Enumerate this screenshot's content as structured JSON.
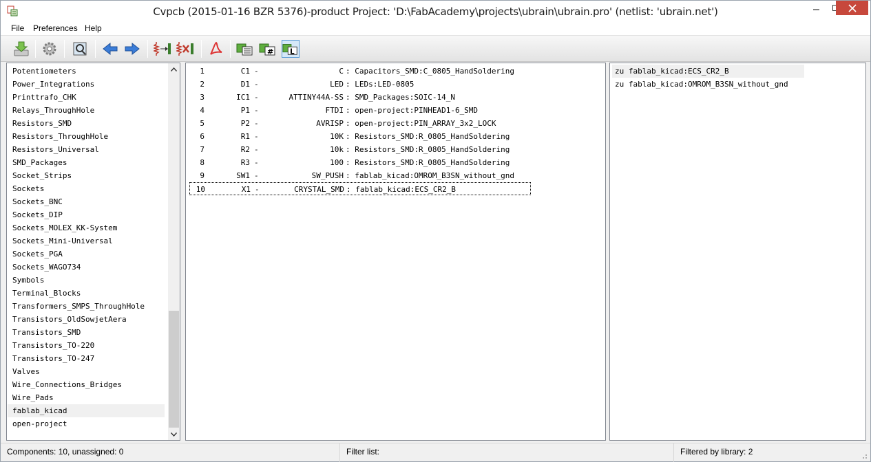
{
  "window": {
    "title": "Cvpcb (2015-01-16 BZR 5376)-product  Project: 'D:\\FabAcademy\\projects\\ubrain\\ubrain.pro'  (netlist: 'ubrain.net')"
  },
  "menu": [
    "File",
    "Preferences",
    "Help"
  ],
  "toolbar": {
    "icons": [
      "save-netlist-icon",
      "config-icon",
      "footprint-libs-icon",
      "prev-icon",
      "next-icon",
      "auto-associate-icon",
      "delete-associations-icon",
      "datasheet-pdf-icon",
      "filter-by-keyword-icon",
      "filter-by-pin-count-icon",
      "filter-by-library-icon"
    ]
  },
  "libraries": [
    "Potentiometers",
    "Power_Integrations",
    "Printtrafo_CHK",
    "Relays_ThroughHole",
    "Resistors_SMD",
    "Resistors_ThroughHole",
    "Resistors_Universal",
    "SMD_Packages",
    "Socket_Strips",
    "Sockets",
    "Sockets_BNC",
    "Sockets_DIP",
    "Sockets_MOLEX_KK-System",
    "Sockets_Mini-Universal",
    "Sockets_PGA",
    "Sockets_WAGO734",
    "Symbols",
    "Terminal_Blocks",
    "Transformers_SMPS_ThroughHole",
    "Transistors_OldSowjetAera",
    "Transistors_SMD",
    "Transistors_TO-220",
    "Transistors_TO-247",
    "Valves",
    "Wire_Connections_Bridges",
    "Wire_Pads",
    "fablab_kicad",
    "open-project"
  ],
  "selected_library": "fablab_kicad",
  "components": [
    {
      "num": "1",
      "ref": "C1",
      "dash": "-",
      "value": "C",
      "footprint": ": Capacitors_SMD:C_0805_HandSoldering"
    },
    {
      "num": "2",
      "ref": "D1",
      "dash": "-",
      "value": "LED",
      "footprint": ": LEDs:LED-0805"
    },
    {
      "num": "3",
      "ref": "IC1",
      "dash": "-",
      "value": "ATTINY44A-SS",
      "footprint": ": SMD_Packages:SOIC-14_N"
    },
    {
      "num": "4",
      "ref": "P1",
      "dash": "-",
      "value": "FTDI",
      "footprint": ": open-project:PINHEAD1-6_SMD"
    },
    {
      "num": "5",
      "ref": "P2",
      "dash": "-",
      "value": "AVRISP",
      "footprint": ": open-project:PIN_ARRAY_3x2_LOCK"
    },
    {
      "num": "6",
      "ref": "R1",
      "dash": "-",
      "value": "10K",
      "footprint": ": Resistors_SMD:R_0805_HandSoldering"
    },
    {
      "num": "7",
      "ref": "R2",
      "dash": "-",
      "value": "10k",
      "footprint": ": Resistors_SMD:R_0805_HandSoldering"
    },
    {
      "num": "8",
      "ref": "R3",
      "dash": "-",
      "value": "100",
      "footprint": ": Resistors_SMD:R_0805_HandSoldering"
    },
    {
      "num": "9",
      "ref": "SW1",
      "dash": "-",
      "value": "SW_PUSH",
      "footprint": ": fablab_kicad:OMROM_B3SN_without_gnd"
    },
    {
      "num": "10",
      "ref": "X1",
      "dash": "-",
      "value": "CRYSTAL_SMD",
      "footprint": ": fablab_kicad:ECS_CR2_B"
    }
  ],
  "focused_component": "10",
  "footprints": [
    "zu fablab_kicad:ECS_CR2_B",
    "zu fablab_kicad:OMROM_B3SN_without_gnd"
  ],
  "status": {
    "components": "Components: 10, unassigned: 0",
    "filter": "Filter list:",
    "filtered": "Filtered by library: 2"
  }
}
